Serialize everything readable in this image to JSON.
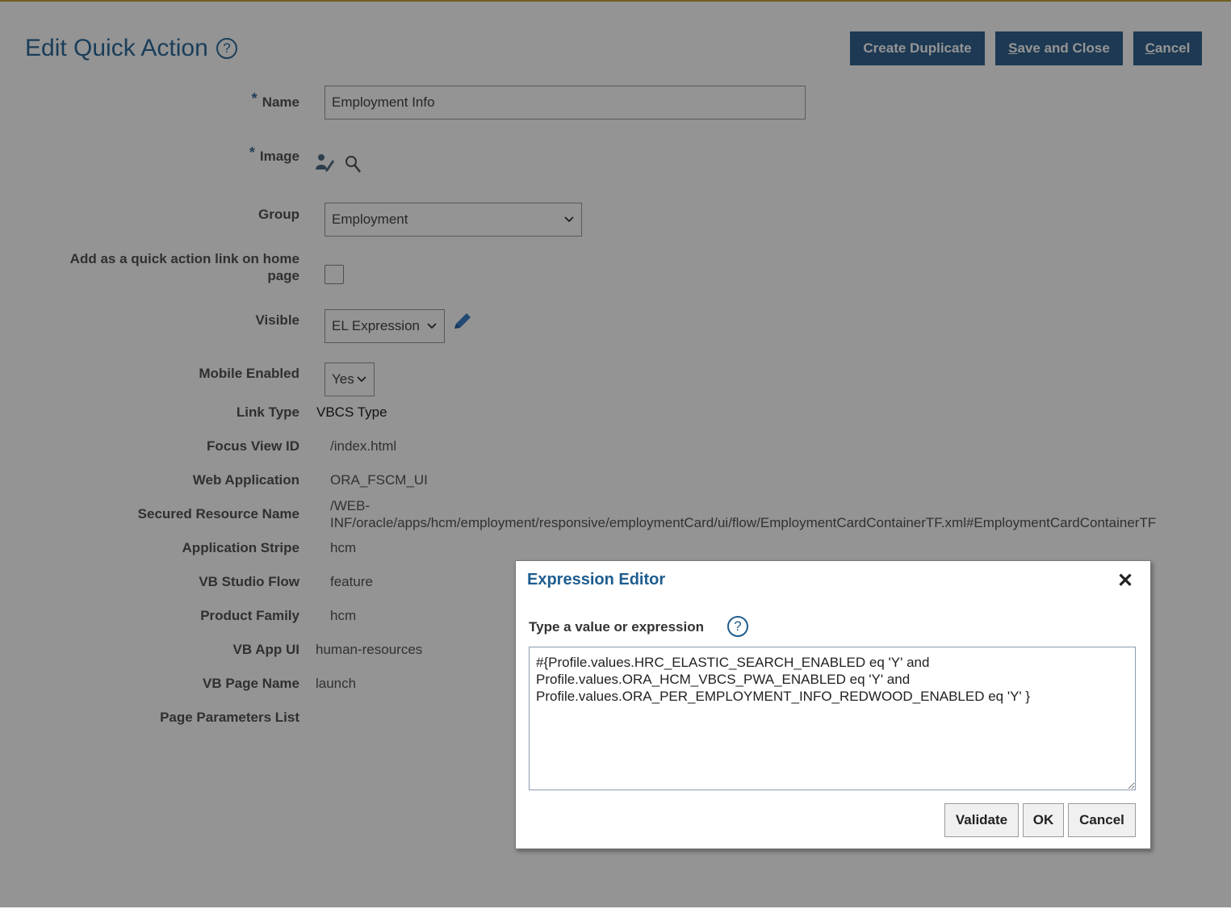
{
  "page": {
    "title": "Edit Quick Action",
    "help_glyph": "?",
    "buttons": {
      "create_duplicate": "Create Duplicate",
      "save_first": "S",
      "save_rest": "ave and Close",
      "cancel_first": "C",
      "cancel_rest": "ancel"
    }
  },
  "form": {
    "required_mark": "*",
    "name_label": "Name",
    "name_value": "Employment Info",
    "image_label": "Image",
    "group_label": "Group",
    "group_value": "Employment",
    "home_link_label": "Add as a quick action link on home page",
    "home_link_checked": false,
    "visible_label": "Visible",
    "visible_value": "EL Expression",
    "mobile_label": "Mobile Enabled",
    "mobile_value": "Yes",
    "link_type_label": "Link Type",
    "link_type_value": "VBCS Type",
    "focus_view_label": "Focus View ID",
    "focus_view_value": "/index.html",
    "web_app_label": "Web Application",
    "web_app_value": "ORA_FSCM_UI",
    "secured_label": "Secured Resource Name",
    "secured_line1": "/WEB-",
    "secured_line2": "INF/oracle/apps/hcm/employment/responsive/employmentCard/ui/flow/EmploymentCardContainerTF.xml#EmploymentCardContainerTF",
    "stripe_label": "Application Stripe",
    "stripe_value": "hcm",
    "flow_label": "VB Studio Flow",
    "flow_value": "feature",
    "family_label": "Product Family",
    "family_value": "hcm",
    "app_ui_label": "VB App UI",
    "app_ui_value": "human-resources",
    "page_name_label": "VB Page Name",
    "page_name_value": "launch",
    "params_label": "Page Parameters List"
  },
  "icons": {
    "image_edit": "user-edit-icon",
    "image_search": "search-icon",
    "visible_edit": "pencil-icon",
    "chevron": "chevron-down-icon",
    "close": "close-icon"
  },
  "colors": {
    "accent": "#33628f",
    "title": "#2d6b9c",
    "dialog_title": "#1f5d8f",
    "top_line": "#c4a53b"
  },
  "dialog": {
    "title": "Expression Editor",
    "close_glyph": "✕",
    "prompt": "Type a value or expression",
    "expression": "#{Profile.values.HRC_ELASTIC_SEARCH_ENABLED eq 'Y' and\nProfile.values.ORA_HCM_VBCS_PWA_ENABLED eq 'Y' and\nProfile.values.ORA_PER_EMPLOYMENT_INFO_REDWOOD_ENABLED eq 'Y' }",
    "validate": "Validate",
    "ok": "OK",
    "cancel": "Cancel"
  }
}
